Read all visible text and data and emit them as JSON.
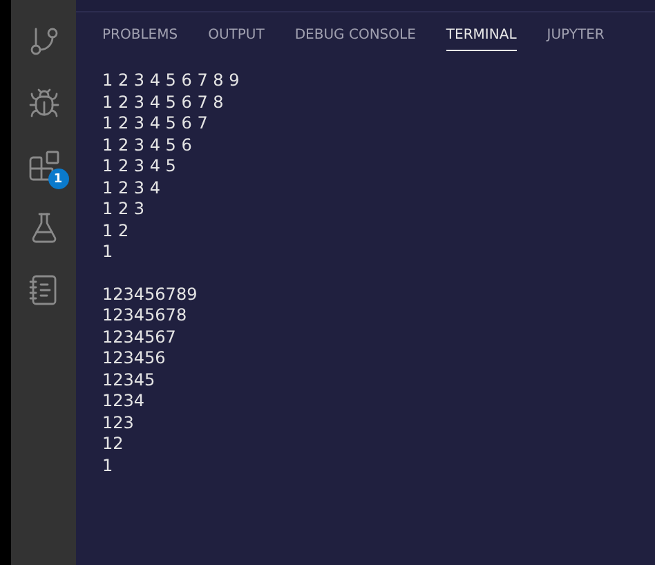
{
  "activity_bar": [
    {
      "kind": "source-control"
    },
    {
      "kind": "run-debug"
    },
    {
      "kind": "extensions",
      "badge": "1"
    },
    {
      "kind": "testing"
    },
    {
      "kind": "notebook"
    }
  ],
  "panel": {
    "tabs": [
      {
        "label": "PROBLEMS",
        "selected": false
      },
      {
        "label": "OUTPUT",
        "selected": false
      },
      {
        "label": "DEBUG CONSOLE",
        "selected": false
      },
      {
        "label": "TERMINAL",
        "selected": true
      },
      {
        "label": "JUPYTER",
        "selected": false
      }
    ],
    "terminal_blocks": [
      [
        "1 2 3 4 5 6 7 8 9",
        "1 2 3 4 5 6 7 8",
        "1 2 3 4 5 6 7",
        "1 2 3 4 5 6",
        "1 2 3 4 5",
        "1 2 3 4",
        "1 2 3",
        "1 2",
        "1"
      ],
      [
        "123456789",
        "12345678",
        "1234567",
        "123456",
        "12345",
        "1234",
        "123",
        "12",
        "1"
      ]
    ]
  }
}
